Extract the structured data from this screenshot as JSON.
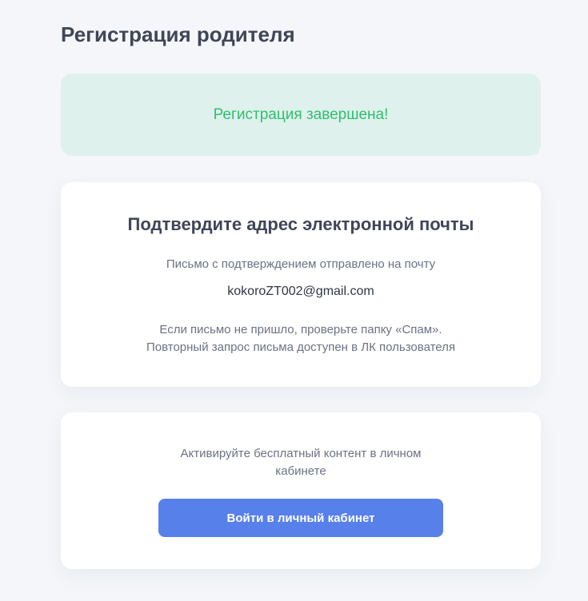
{
  "page": {
    "title": "Регистрация родителя"
  },
  "banner": {
    "message": "Регистрация завершена!",
    "color": "#2fbf71",
    "background": "#dff1ec"
  },
  "confirm_card": {
    "heading": "Подтвердите адрес электронной почты",
    "sent_text": "Письмо с подтверждением отправлено на почту",
    "email": "kokoroZT002@gmail.com",
    "spam_line1": "Если письмо не пришло, проверьте папку «Спам».",
    "spam_line2": "Повторный запрос письма доступен в ЛК пользователя"
  },
  "activate_card": {
    "text": "Активируйте бесплатный контент в личном кабинете",
    "button_label": "Войти в личный кабинет",
    "button_color": "#5880ea"
  }
}
